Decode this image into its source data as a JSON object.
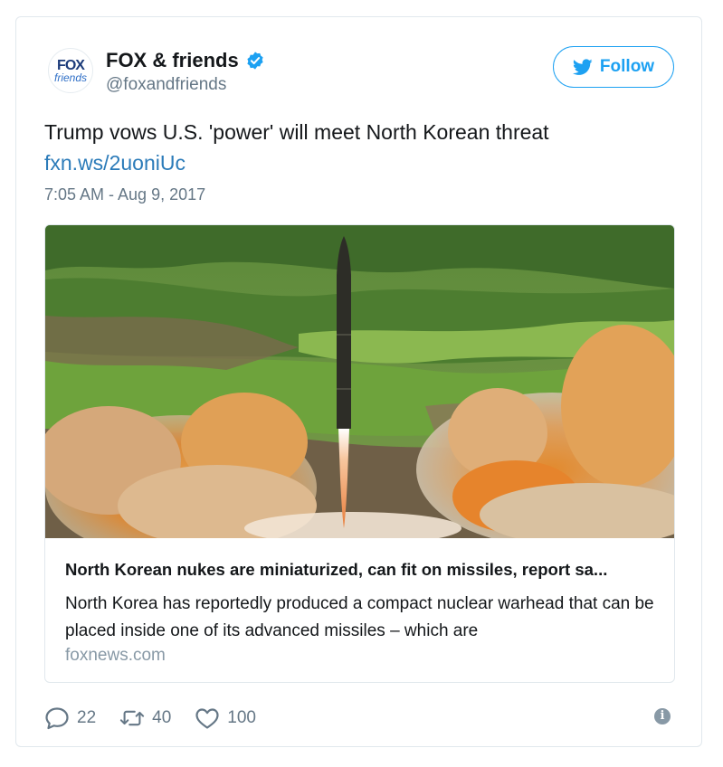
{
  "author": {
    "avatar_logo_top": "FOX",
    "avatar_logo_bottom": "friends",
    "name": "FOX & friends",
    "handle": "@foxandfriends",
    "verified": true
  },
  "follow_label": "Follow",
  "tweet": {
    "text": "Trump vows U.S. 'power' will meet North Korean threat",
    "link": "fxn.ws/2uoniUc",
    "timestamp": "7:05 AM - Aug 9, 2017"
  },
  "card": {
    "image_alt": "missile launch over green hills with orange smoke",
    "title": "North Korean nukes are miniaturized, can fit on missiles, report sa...",
    "description": "North Korea has reportedly produced a compact nuclear warhead that can be placed inside one of its advanced missiles – which are",
    "domain": "foxnews.com"
  },
  "actions": {
    "replies": "22",
    "retweets": "40",
    "likes": "100"
  },
  "icons": [
    "verified-icon",
    "twitter-bird-icon",
    "reply-icon",
    "retweet-icon",
    "like-icon",
    "info-icon"
  ],
  "colors": {
    "accent": "#1da1f2",
    "link": "#2b7bb9",
    "muted": "#657786"
  }
}
